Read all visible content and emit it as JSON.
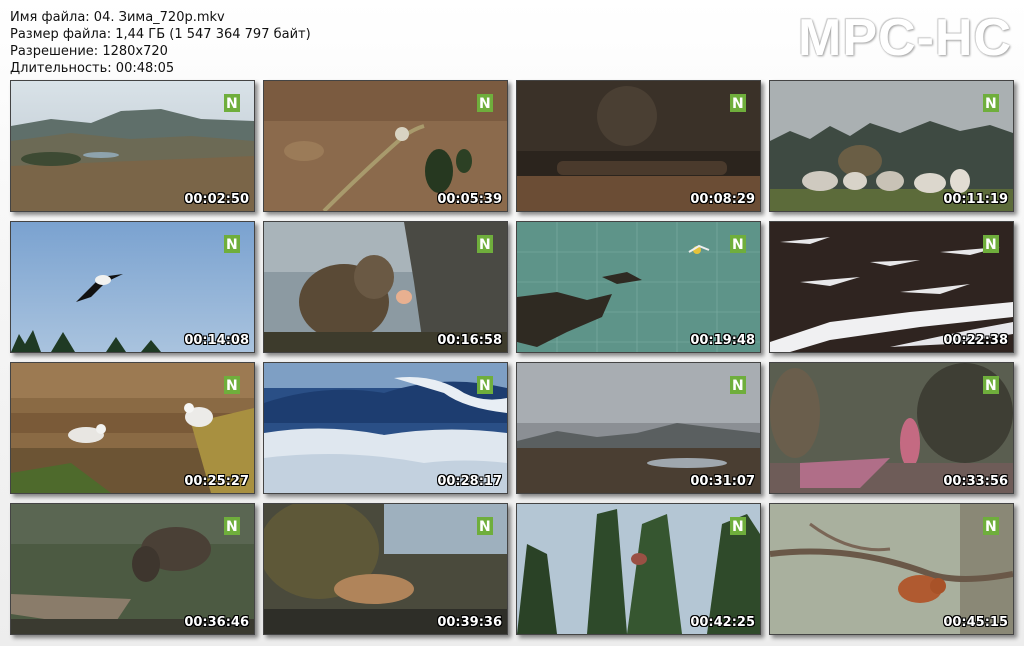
{
  "file_info": {
    "filename": "Имя файла: 04. Зима_720p.mkv",
    "filesize": "Размер файла: 1,44 ГБ (1 547 364 797 байт)",
    "resolution": "Разрешение: 1280x720",
    "duration": "Длительность: 00:48:05"
  },
  "brand": "MPC-HC",
  "channel_logo": "N-channel-logo",
  "thumbnails": [
    {
      "time": "00:02:50",
      "scene": "mountain-landscape"
    },
    {
      "time": "00:05:39",
      "scene": "aerial-moorland-hut"
    },
    {
      "time": "00:08:29",
      "scene": "dark-interior-loom"
    },
    {
      "time": "00:11:19",
      "scene": "sheep-in-field"
    },
    {
      "time": "00:14:08",
      "scene": "bird-in-flight"
    },
    {
      "time": "00:16:58",
      "scene": "otter-on-rocks"
    },
    {
      "time": "00:19:48",
      "scene": "map-animation"
    },
    {
      "time": "00:22:38",
      "scene": "snowy-moor"
    },
    {
      "time": "00:25:27",
      "scene": "seagulls-on-cliff"
    },
    {
      "time": "00:28:17",
      "scene": "stormy-sea-waves"
    },
    {
      "time": "00:31:07",
      "scene": "highland-loch"
    },
    {
      "time": "00:33:56",
      "scene": "eagle-with-prey"
    },
    {
      "time": "00:36:46",
      "scene": "goat-grazing"
    },
    {
      "time": "00:39:36",
      "scene": "otter-on-shore"
    },
    {
      "time": "00:42:25",
      "scene": "bird-on-pine"
    },
    {
      "time": "00:45:15",
      "scene": "red-squirrel-branch"
    }
  ]
}
